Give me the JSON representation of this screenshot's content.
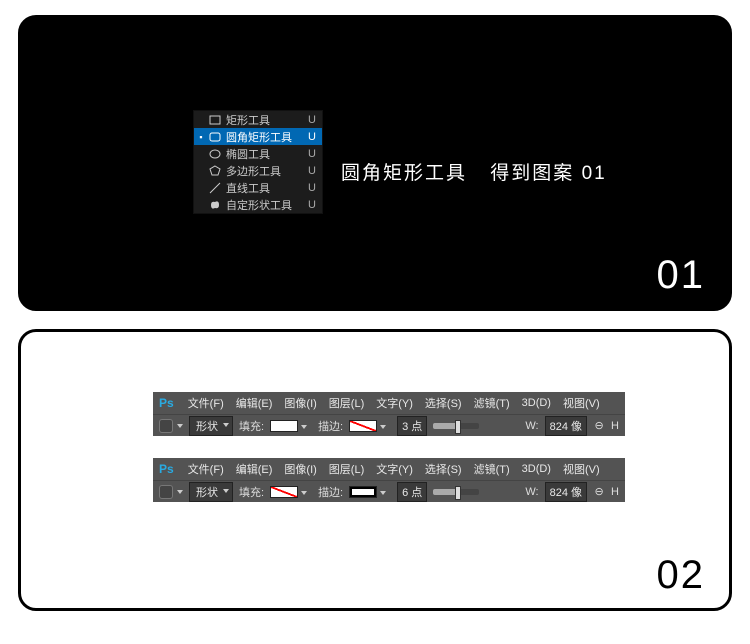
{
  "panel01": {
    "big_number": "01",
    "caption_main": "圆角矩形工具",
    "caption_sub": "得到图案  01",
    "flyout": {
      "items": [
        {
          "label": "矩形工具",
          "key": "U",
          "selected": false,
          "icon": "rect"
        },
        {
          "label": "圆角矩形工具",
          "key": "U",
          "selected": true,
          "icon": "rrect"
        },
        {
          "label": "椭圆工具",
          "key": "U",
          "selected": false,
          "icon": "ellipse"
        },
        {
          "label": "多边形工具",
          "key": "U",
          "selected": false,
          "icon": "polygon"
        },
        {
          "label": "直线工具",
          "key": "U",
          "selected": false,
          "icon": "line"
        },
        {
          "label": "自定形状工具",
          "key": "U",
          "selected": false,
          "icon": "blob"
        }
      ]
    }
  },
  "panel02": {
    "big_number": "02",
    "ps_blocks": [
      {
        "menus": [
          "文件(F)",
          "编辑(E)",
          "图像(I)",
          "图层(L)",
          "文字(Y)",
          "选择(S)",
          "滤镜(T)",
          "3D(D)",
          "视图(V)"
        ],
        "shape_mode": "形状",
        "fill_label": "填充:",
        "fill_swatch": "white",
        "stroke_label": "描边:",
        "stroke_swatch": "none",
        "stroke_width": "3 点",
        "w_label": "W:",
        "w_value": "824 像",
        "h_label": "H"
      },
      {
        "menus": [
          "文件(F)",
          "编辑(E)",
          "图像(I)",
          "图层(L)",
          "文字(Y)",
          "选择(S)",
          "滤镜(T)",
          "3D(D)",
          "视图(V)"
        ],
        "shape_mode": "形状",
        "fill_label": "填充:",
        "fill_swatch": "none",
        "stroke_label": "描边:",
        "stroke_swatch": "outline_black",
        "stroke_width": "6 点",
        "w_label": "W:",
        "w_value": "824 像",
        "h_label": "H"
      }
    ]
  },
  "ps_logo": "Ps"
}
